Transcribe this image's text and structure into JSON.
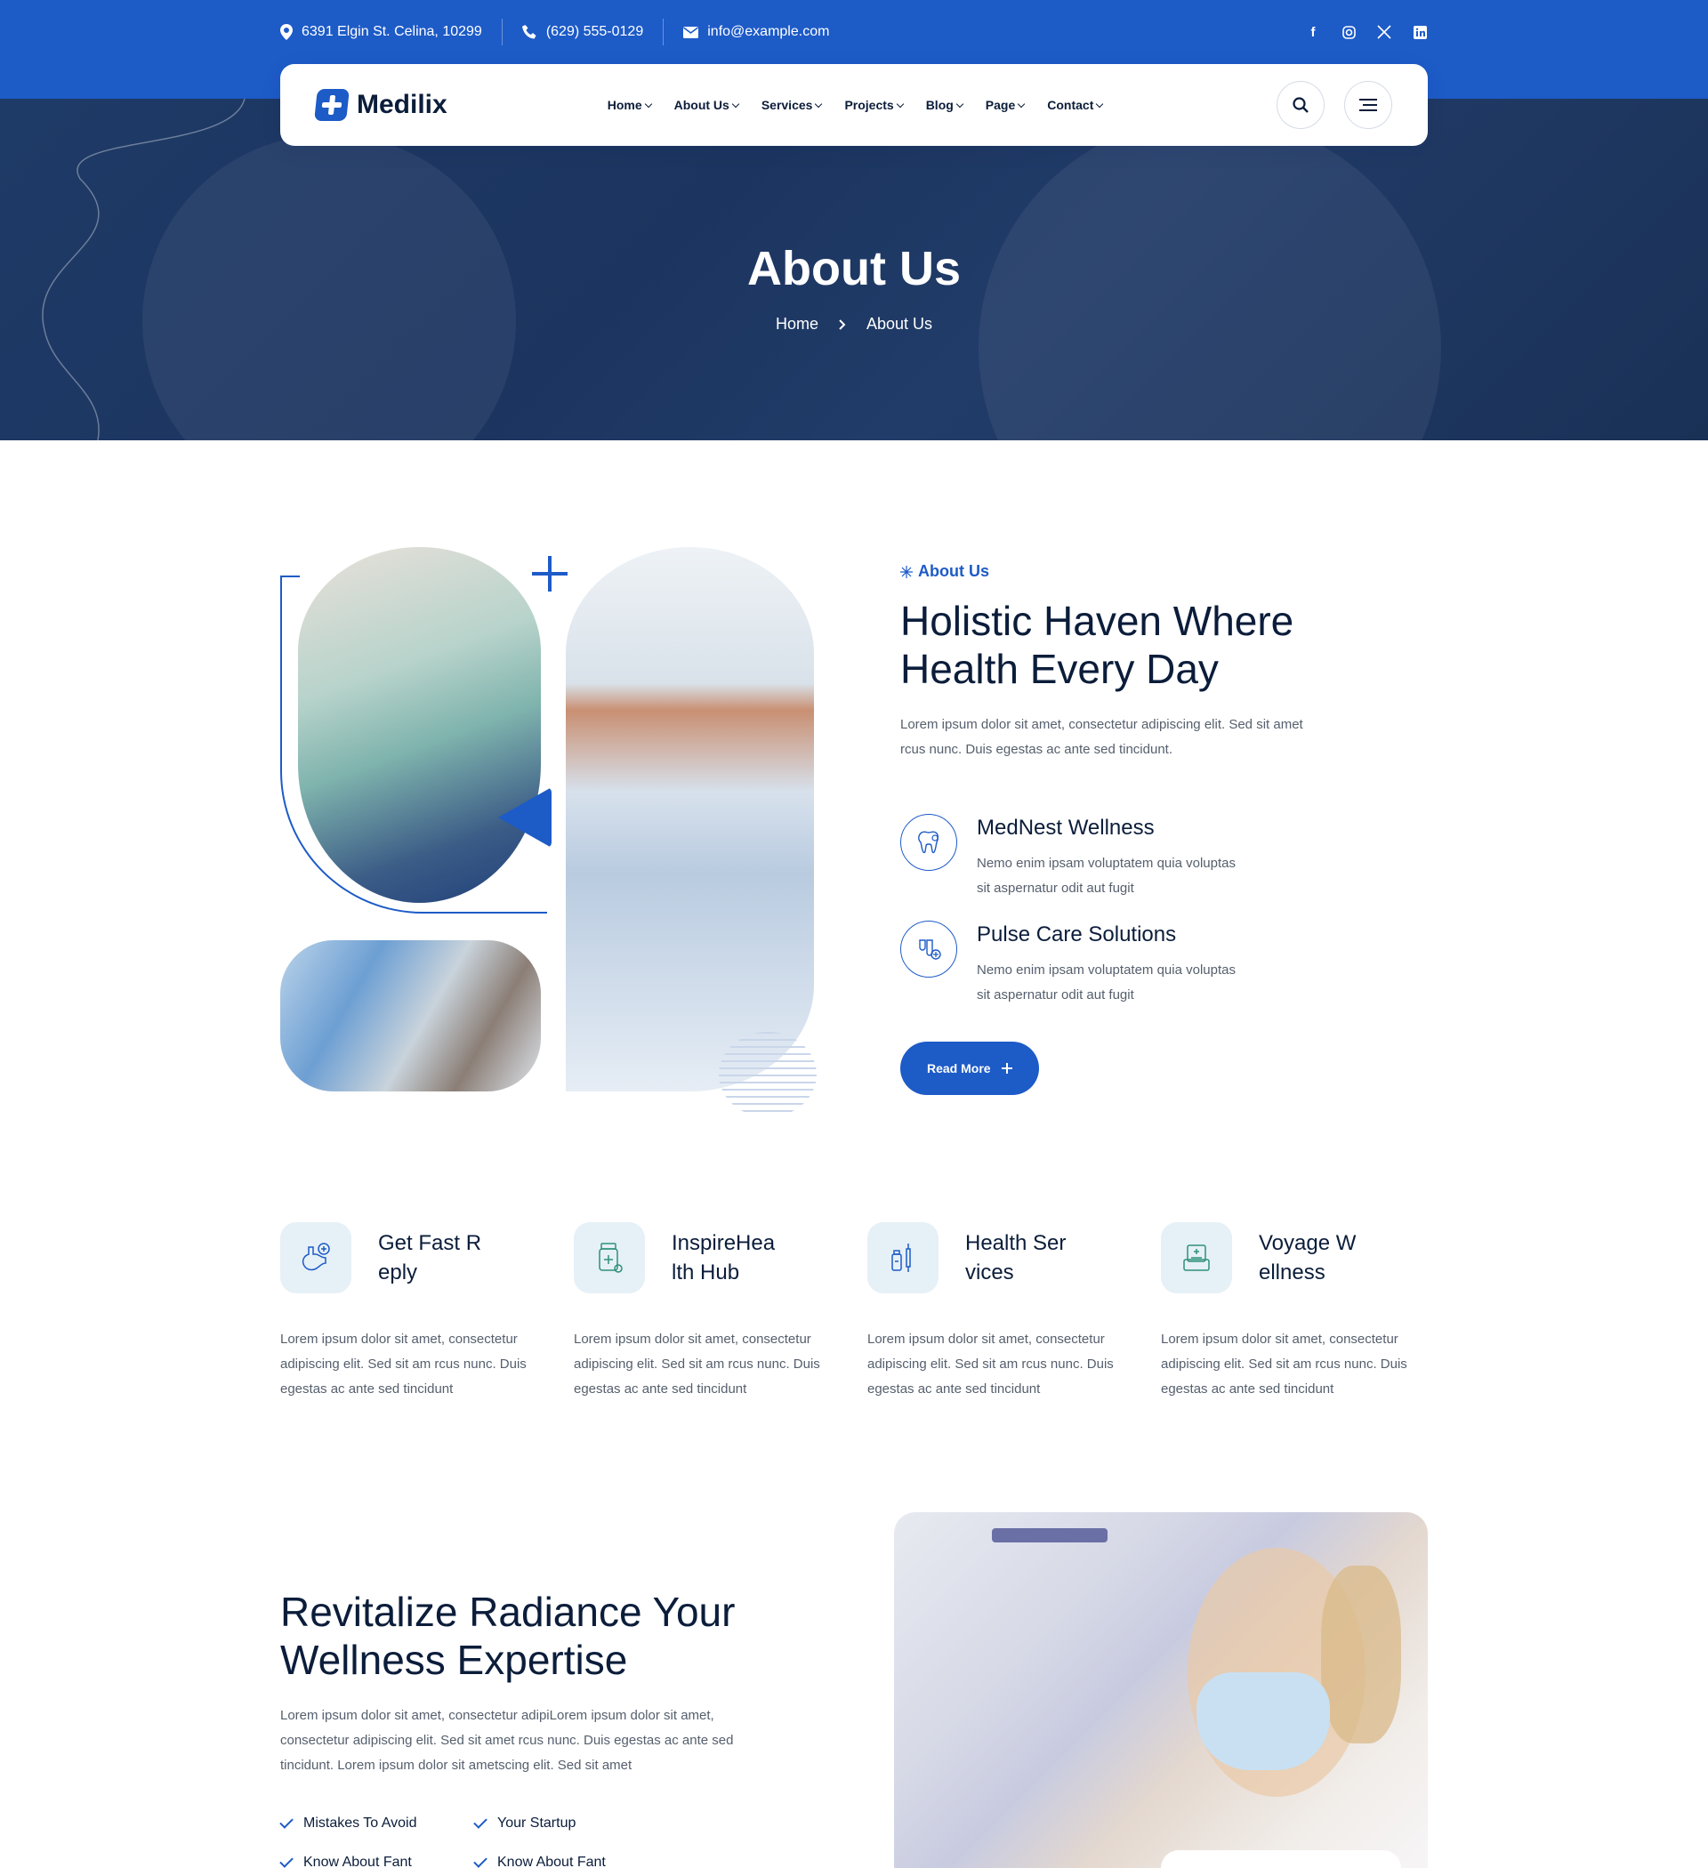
{
  "topbar": {
    "address": "6391 Elgin St. Celina, 10299",
    "phone": "(629) 555-0129",
    "email": "info@example.com",
    "social": [
      "facebook-icon",
      "instagram-icon",
      "x-icon",
      "linkedin-icon"
    ]
  },
  "nav": {
    "logo": "Medilix",
    "menu": [
      "Home",
      "About Us",
      "Services",
      "Projects",
      "Blog",
      "Page",
      "Contact"
    ]
  },
  "hero": {
    "title": "About Us",
    "breadcrumb": [
      "Home",
      "About Us"
    ]
  },
  "about": {
    "eyebrow": "About Us",
    "heading_line1": "Holistic Haven Where",
    "heading_line2": "Health Every Day",
    "desc_line1": "Lorem ipsum dolor sit amet, consectetur adipiscing elit. Sed sit amet",
    "desc_line2": "rcus nunc. Duis egestas ac ante sed tincidunt.",
    "features": [
      {
        "title": "MedNest Wellness",
        "line1": "Nemo enim ipsam voluptatem quia voluptas",
        "line2": "sit aspernatur odit aut fugit"
      },
      {
        "title": "Pulse Care Solutions",
        "line1": "Nemo enim ipsam voluptatem quia voluptas",
        "line2": "sit aspernatur odit aut fugit"
      }
    ],
    "button": "Read More"
  },
  "cards": [
    {
      "title": "Get Fast Reply",
      "l1": "Lorem ipsum dolor sit amet, consectetur",
      "l2": "adipiscing elit. Sed sit am rcus nunc. Duis",
      "l3": "egestas ac ante sed tincidunt"
    },
    {
      "title": "InspireHealth Hub",
      "l1": "Lorem ipsum dolor sit amet, consectetur",
      "l2": "adipiscing elit. Sed sit am rcus nunc. Duis",
      "l3": "egestas ac ante sed tincidunt"
    },
    {
      "title": "Health Services",
      "l1": "Lorem ipsum dolor sit amet, consectetur",
      "l2": "adipiscing elit. Sed sit am rcus nunc. Duis",
      "l3": "egestas ac ante sed tincidunt"
    },
    {
      "title": "Voyage Wellness",
      "l1": "Lorem ipsum dolor sit amet, consectetur",
      "l2": "adipiscing elit. Sed sit am rcus nunc. Duis",
      "l3": "egestas ac ante sed tincidunt"
    }
  ],
  "revitalize": {
    "heading_line1": "Revitalize Radiance Your",
    "heading_line2": "Wellness Expertise",
    "l1": "Lorem ipsum dolor sit amet, consectetur adipiLorem ipsum dolor sit amet,",
    "l2": "consectetur adipiscing elit. Sed sit amet rcus nunc. Duis egestas ac ante sed",
    "l3": "tincidunt. Lorem ipsum dolor sit ametscing elit. Sed sit amet",
    "checks": [
      "Mistakes To Avoid",
      "Your Startup",
      "Know About Fant",
      "Know About Fant"
    ]
  },
  "colors": {
    "primary": "#1d5bc7",
    "navy": "#0b1d3a",
    "text": "#555f6d",
    "icon_bg": "#e6f0f7"
  }
}
